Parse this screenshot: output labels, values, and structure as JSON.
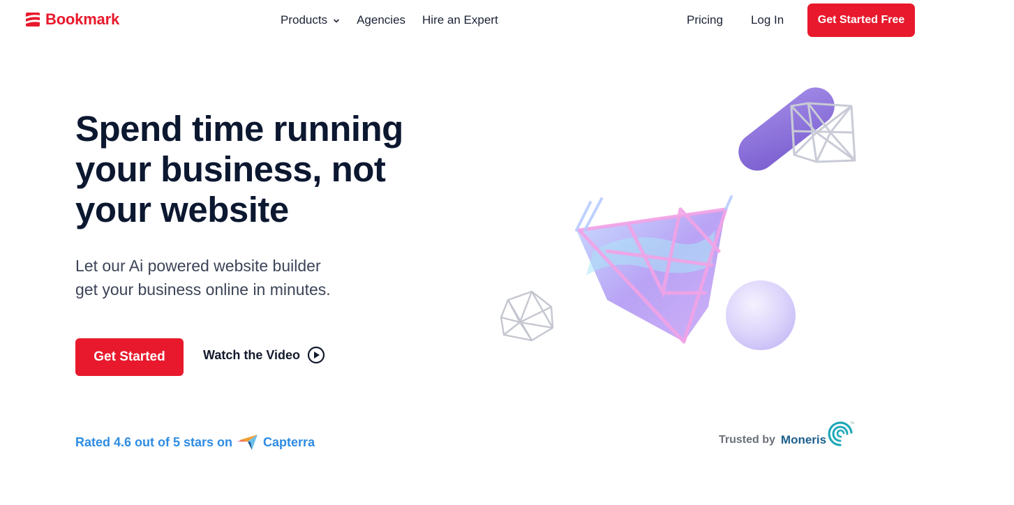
{
  "brand": {
    "name": "Bookmark",
    "icon": "bookmark-stack-icon",
    "color": "#e8192c"
  },
  "nav": {
    "products": "Products",
    "products_icon": "chevron-down-icon",
    "agencies": "Agencies",
    "hire_expert": "Hire an Expert",
    "pricing": "Pricing",
    "login": "Log In",
    "cta": "Get Started Free"
  },
  "hero": {
    "title_lines": [
      "Spend time running",
      "your business, not",
      "your website"
    ],
    "subtitle_lines": [
      "Let our Ai powered website builder",
      "get your business online in minutes."
    ],
    "primary_button": "Get Started",
    "video_link": "Watch the Video",
    "video_icon": "play-circle-icon"
  },
  "rating": {
    "text": "Rated 4.6 out of 5 stars on",
    "score": 4.6,
    "max": 5,
    "platform": "Capterra",
    "platform_icon": "capterra-logo-icon",
    "color": "#2d8ce3"
  },
  "trust": {
    "label": "Trusted by",
    "partner": "Moneris",
    "partner_icon": "moneris-swirl-icon"
  },
  "illustration": {
    "shapes": [
      "purple-capsule",
      "wireframe-cube",
      "glass-crystal-basket",
      "wireframe-icosahedron",
      "lavender-sphere"
    ]
  },
  "colors": {
    "accent": "#e8192c",
    "heading": "#0c1730",
    "body": "#3c4457",
    "link": "#2d8ce3",
    "capsule": "#8a6fd6"
  }
}
